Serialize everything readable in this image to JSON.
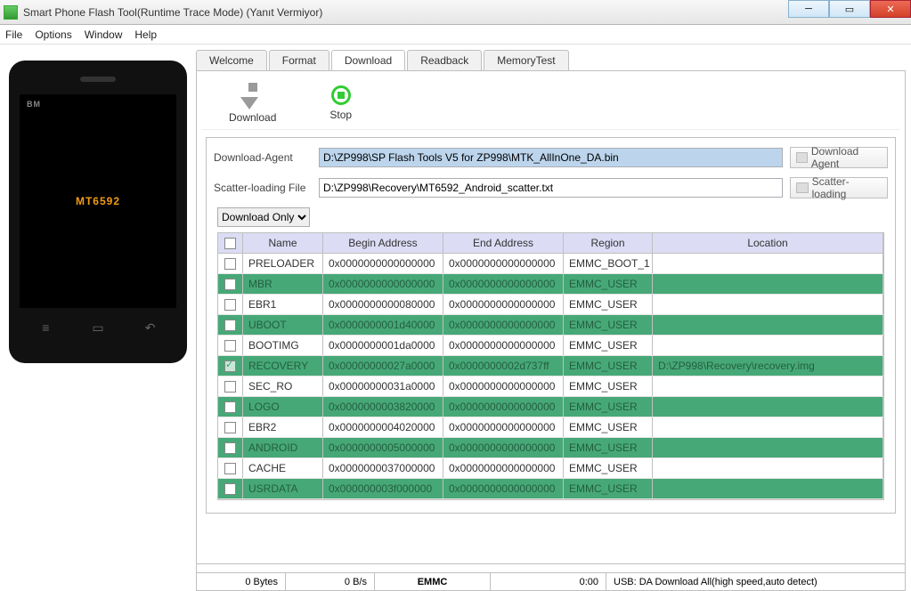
{
  "window": {
    "title": "Smart Phone Flash Tool(Runtime Trace Mode) (Yanıt Vermiyor)"
  },
  "menu": {
    "file": "File",
    "options": "Options",
    "window": "Window",
    "help": "Help"
  },
  "phone": {
    "chip": "MT6592",
    "bm": "BM"
  },
  "tabs": {
    "welcome": "Welcome",
    "format": "Format",
    "download": "Download",
    "readback": "Readback",
    "memorytest": "MemoryTest"
  },
  "toolbar": {
    "download": "Download",
    "stop": "Stop"
  },
  "agent": {
    "da_label": "Download-Agent",
    "da_path": "D:\\ZP998\\SP Flash Tools V5 for ZP998\\MTK_AllInOne_DA.bin",
    "da_btn": "Download Agent",
    "scatter_label": "Scatter-loading File",
    "scatter_path": "D:\\ZP998\\Recovery\\MT6592_Android_scatter.txt",
    "scatter_btn": "Scatter-loading",
    "mode": "Download Only"
  },
  "table": {
    "headers": {
      "name": "Name",
      "begin": "Begin Address",
      "end": "End Address",
      "region": "Region",
      "location": "Location"
    },
    "rows": [
      {
        "chk": false,
        "alt": false,
        "name": "PRELOADER",
        "ba": "0x0000000000000000",
        "ea": "0x0000000000000000",
        "reg": "EMMC_BOOT_1",
        "loc": ""
      },
      {
        "chk": false,
        "alt": true,
        "name": "MBR",
        "ba": "0x0000000000000000",
        "ea": "0x0000000000000000",
        "reg": "EMMC_USER",
        "loc": ""
      },
      {
        "chk": false,
        "alt": false,
        "name": "EBR1",
        "ba": "0x0000000000080000",
        "ea": "0x0000000000000000",
        "reg": "EMMC_USER",
        "loc": ""
      },
      {
        "chk": false,
        "alt": true,
        "name": "UBOOT",
        "ba": "0x0000000001d40000",
        "ea": "0x0000000000000000",
        "reg": "EMMC_USER",
        "loc": ""
      },
      {
        "chk": false,
        "alt": false,
        "name": "BOOTIMG",
        "ba": "0x0000000001da0000",
        "ea": "0x0000000000000000",
        "reg": "EMMC_USER",
        "loc": ""
      },
      {
        "chk": true,
        "alt": true,
        "name": "RECOVERY",
        "ba": "0x00000000027a0000",
        "ea": "0x0000000002d737ff",
        "reg": "EMMC_USER",
        "loc": "D:\\ZP998\\Recovery\\recovery.img"
      },
      {
        "chk": false,
        "alt": false,
        "name": "SEC_RO",
        "ba": "0x00000000031a0000",
        "ea": "0x0000000000000000",
        "reg": "EMMC_USER",
        "loc": ""
      },
      {
        "chk": false,
        "alt": true,
        "name": "LOGO",
        "ba": "0x0000000003820000",
        "ea": "0x0000000000000000",
        "reg": "EMMC_USER",
        "loc": ""
      },
      {
        "chk": false,
        "alt": false,
        "name": "EBR2",
        "ba": "0x0000000004020000",
        "ea": "0x0000000000000000",
        "reg": "EMMC_USER",
        "loc": ""
      },
      {
        "chk": false,
        "alt": true,
        "name": "ANDROID",
        "ba": "0x0000000005000000",
        "ea": "0x0000000000000000",
        "reg": "EMMC_USER",
        "loc": ""
      },
      {
        "chk": false,
        "alt": false,
        "name": "CACHE",
        "ba": "0x0000000037000000",
        "ea": "0x0000000000000000",
        "reg": "EMMC_USER",
        "loc": ""
      },
      {
        "chk": false,
        "alt": true,
        "name": "USRDATA",
        "ba": "0x000000003f000000",
        "ea": "0x0000000000000000",
        "reg": "EMMC_USER",
        "loc": ""
      }
    ]
  },
  "status": {
    "bytes": "0 Bytes",
    "bps": "0 B/s",
    "mem": "EMMC",
    "time": "0:00",
    "mode": "USB: DA Download All(high speed,auto detect)"
  }
}
